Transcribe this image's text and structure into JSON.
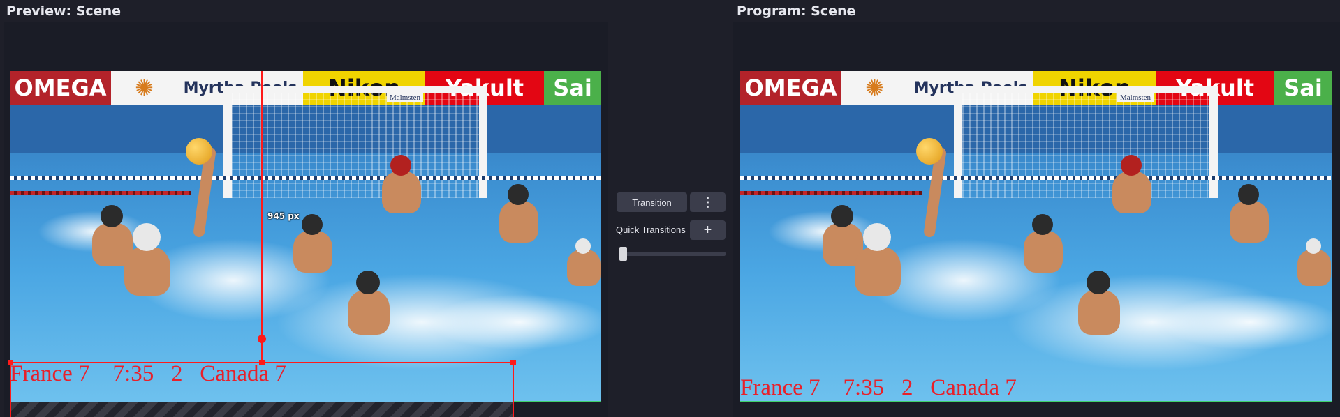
{
  "preview": {
    "title": "Preview: Scene",
    "score_overlay": "France 7    7:35   2   Canada 7",
    "measure_label": "945 px"
  },
  "program": {
    "title": "Program: Scene",
    "score_overlay": "France 7    7:35   2   Canada 7"
  },
  "transition": {
    "button_label": "Transition",
    "more_icon": "vertical-dots-icon",
    "quick_label": "Quick Transitions",
    "add_icon": "plus-icon",
    "slider_value": 0
  },
  "ads": [
    {
      "text": "OMEGA",
      "bg": "#b3232a",
      "fg": "#ffffff"
    },
    {
      "text": "✺",
      "bg": "#f4f4f4",
      "fg": "#d77b1c"
    },
    {
      "text": "Myrtha Pools",
      "bg": "#f4f4f4",
      "fg": "#24335c"
    },
    {
      "text": "Nikon",
      "bg": "#f0d400",
      "fg": "#111111"
    },
    {
      "text": "Yakult",
      "bg": "#e30613",
      "fg": "#ffffff"
    },
    {
      "text": "Sai",
      "bg": "#4bb04a",
      "fg": "#ffffff"
    }
  ],
  "goal_brand": "Malmsten",
  "colors": {
    "background": "#1e1f29",
    "selection": "#ff1a1a",
    "overlay_text": "#e8202a",
    "active_edge": "#3fd16b"
  }
}
